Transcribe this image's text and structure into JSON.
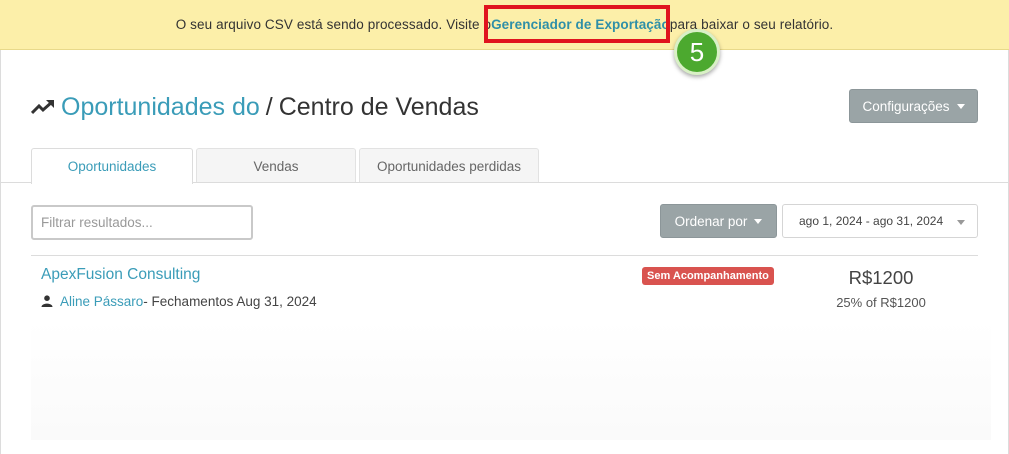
{
  "banner": {
    "text_before": "O seu arquivo CSV está sendo processado. Visite o ",
    "link": "Gerenciador de Exportação",
    "text_after": " para baixar o seu relatório.",
    "step_number": "5",
    "highlight_color": "#e0141e",
    "badge_color": "#4ca92f"
  },
  "header": {
    "trend_icon": "trending-up-icon",
    "title_link": "Oportunidades do",
    "separator": "/",
    "title_main": "Centro de Vendas",
    "settings_label": "Configurações"
  },
  "tabs": [
    {
      "label": "Oportunidades",
      "active": true
    },
    {
      "label": "Vendas",
      "active": false
    },
    {
      "label": "Oportunidades perdidas",
      "active": false
    }
  ],
  "filters": {
    "search_placeholder": "Filtrar resultados...",
    "search_value": "",
    "sort_label": "Ordenar por",
    "date_range": "ago 1, 2024 - ago 31, 2024"
  },
  "opportunities": [
    {
      "name": "ApexFusion Consulting",
      "owner": "Aline Pássaro",
      "closing_text": " - Fechamentos Aug 31, 2024",
      "status": "Sem Acompanhamento",
      "amount": "R$1200",
      "probability": "25% of R$1200"
    }
  ],
  "colors": {
    "accent": "#3a9cb8",
    "banner_bg": "#fcefa9",
    "button_gray": "#9aa4a6",
    "status_red": "#d9534f"
  }
}
